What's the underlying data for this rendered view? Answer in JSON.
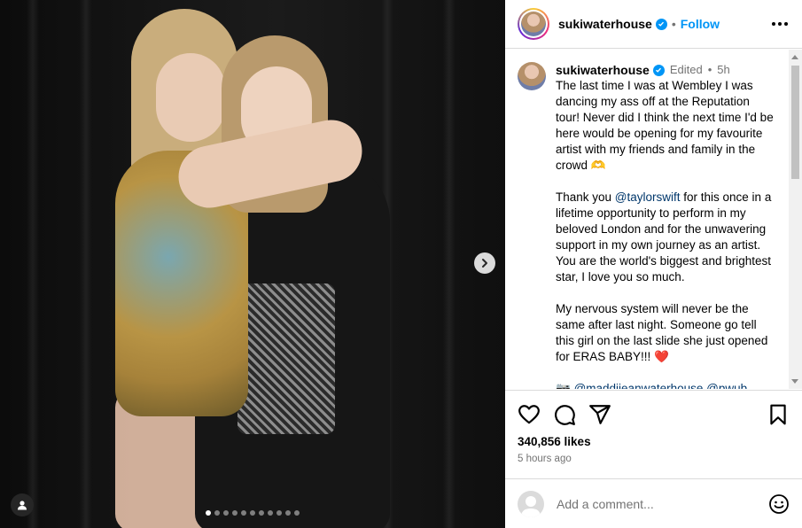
{
  "post": {
    "username": "sukiwaterhouse",
    "follow_label": "Follow",
    "separator": "•",
    "edited_label": "Edited",
    "time_ago_short": "5h",
    "caption_paragraphs": [
      "The last time I was at Wembley I was dancing my ass off at the Reputation tour! Never did I think the next time I'd be here would be opening for my favourite artist with my friends and family in the crowd 🫶",
      "My nervous system will never be the same after last night. Someone go tell this girl on the last slide she just opened for ERAS BABY!!!"
    ],
    "thank_you": {
      "prefix": "Thank you ",
      "mention": "@taylorswift",
      "suffix": " for this once in a lifetime opportunity to perform in my beloved London and for the unwavering support in my own journey as an artist. You are the world's biggest and brightest star, I love you so much."
    },
    "heart_emoji": "❤️",
    "camera_emoji": "📷",
    "tagged_mentions": "@maddiieanwaterhouse @pwub",
    "likes_text": "340,856 likes",
    "posted_ago": "5 hours ago"
  },
  "comment": {
    "placeholder": "Add a comment..."
  },
  "carousel": {
    "slide_count": 11,
    "active_index": 0
  },
  "icons": {
    "verified": "verified-badge-icon",
    "more": "more-options-icon",
    "like": "heart-icon",
    "comment": "comment-bubble-icon",
    "share": "paper-plane-icon",
    "save": "bookmark-icon",
    "emoji": "smiley-icon",
    "next": "chevron-right-icon",
    "tag": "user-tag-icon"
  },
  "colors": {
    "accent": "#0095f6",
    "mention": "#00376b",
    "muted": "#737373",
    "heart": "#e0245e"
  }
}
